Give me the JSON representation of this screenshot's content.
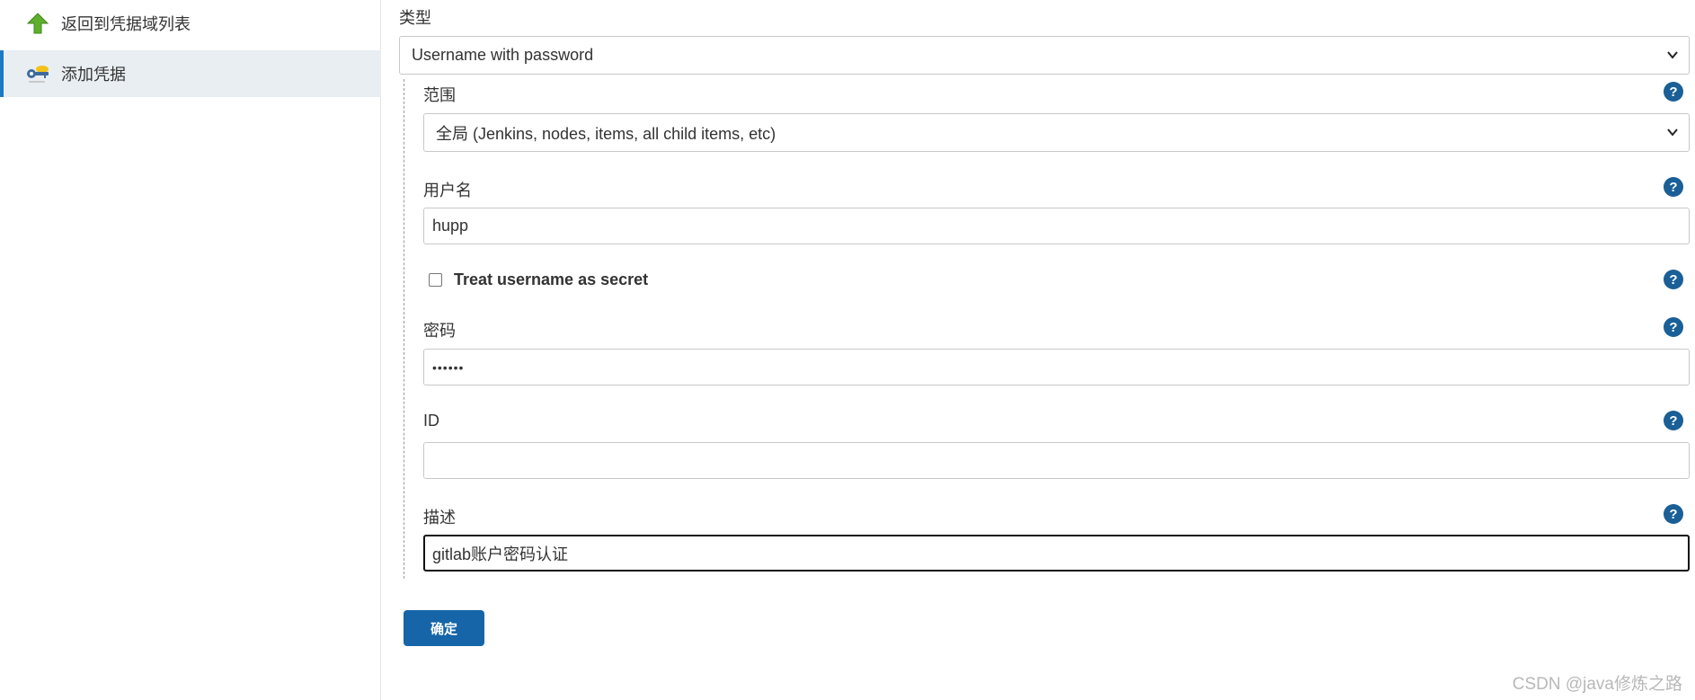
{
  "sidebar": {
    "items": [
      {
        "label": "返回到凭据域列表",
        "icon": "up-arrow-icon"
      },
      {
        "label": "添加凭据",
        "icon": "key-icon",
        "active": true
      }
    ]
  },
  "form": {
    "kind": {
      "label": "类型",
      "value": "Username with password"
    },
    "scope": {
      "label": "范围",
      "value": "全局 (Jenkins, nodes, items, all child items, etc)"
    },
    "username": {
      "label": "用户名",
      "value": "hupp"
    },
    "secret_checkbox": {
      "label": "Treat username as secret",
      "checked": false
    },
    "password": {
      "label": "密码",
      "value": "••••••"
    },
    "id": {
      "label": "ID",
      "value": ""
    },
    "description": {
      "label": "描述",
      "value": "gitlab账户密码认证"
    },
    "help_glyph": "?",
    "submit_label": "确定"
  },
  "watermark": "CSDN @java修炼之路",
  "colors": {
    "accent": "#1565a8",
    "help": "#1a5f96",
    "active_bg": "#e9eef2",
    "active_border": "#1c79c7"
  }
}
